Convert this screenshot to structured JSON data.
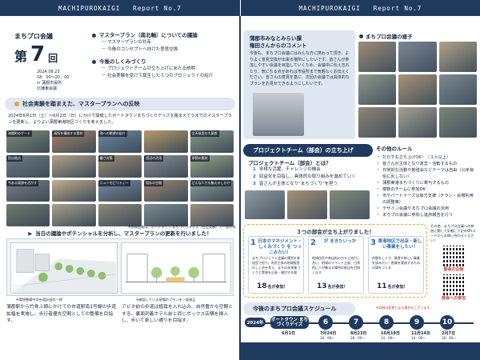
{
  "header": {
    "left": {
      "org": "MACHIPUROKAIGI",
      "issue": "Report  No.7"
    },
    "right": {
      "org": "MACHIPUROKAIGI",
      "issue": "Report  No.7"
    }
  },
  "title": {
    "name": "まちプロ会議",
    "dai": "第",
    "number": "7",
    "kai": "回",
    "date": "2024.08.23",
    "time": "18：00～20：00",
    "venue_prefix": "in",
    "venue_line1": "蒲郡市役所",
    "venue_line2": "北棟東会議"
  },
  "agenda": [
    {
      "heading": "マスタープラン（南北軸）についての議論",
      "items": [
        "マスタープランの共有",
        "今後のコンセプトへ向けた意見交換"
      ]
    },
    {
      "heading": "今後のしくみづくり",
      "items": [
        "プロジェクトチームの立ち上げにあたる説明",
        "社会実験を受けて誕生した３つのプロジェクトの紹介"
      ]
    }
  ],
  "section1": {
    "title": "社会実験を踏まえた、マスタープランへの反映",
    "intro": "2024年6月1日（土）～6月2日（日）にかけて開催したポートタウンまちづくりデイズを踏まえてラまでのマスタープランを更新し、よりよい蒲郡東港地区づくりを考えました。"
  },
  "photo_captions": [
    "海陽町のゲート",
    "高所を構成する素材",
    "海への眺望の抜け",
    "",
    "全天候型の大屋根",
    "防災拠点",
    "",
    "暑さ対策",
    "窓辺の活用",
    "季節の素材",
    "今ある資源を活かす",
    "",
    "ニューモビリティー",
    "既存の空間",
    "どんな人でも集えるしかけ",
    "",
    "",
    "",
    "",
    ""
  ],
  "notes": {
    "photos": "※画像出典は、ポートタウン まちづくりデイズ（社会実験）で一部作成",
    "drawing_left": "※環境整備中の歩道計画の一例",
    "drawing_right": "※確認している現場のプランを一部修正"
  },
  "section2_title": "当日の議論やポテンシャルを分析し、マスタープランの更新を行いました！",
  "bottom_left_text": "蒲郡駅から竹島ふ頭にかけての市道駅南1号線の歩道拡幅を実施し、歩行者優先空間としての整備を目指す。",
  "bottom_right_text": "アピタ前の歩道は植栽を入れ込み、自然豊かな空間とする。裏面到着ホテル前と同じボックス店舗を挿入し、歩いて楽しい通りを目指す。",
  "comment": {
    "title1": "蒲郡市みなとみらい課",
    "title2": "権田さんからのコメント",
    "body": "今後も、まちプロ会議にはみんな方に携わって頂き、よりよく意見交換が出来る場所にしたいです。皆さんが参加しやすい会議を目指していくため、会議中に伝え忘れたり、気になる点があれば市役所まで気軽なくお伝えください。皆さんの意見を基に、次回の会議では具体的なプランをお見せできるようにしたいです。"
  },
  "scene_label": "まちプロ会議の様子",
  "project": {
    "header": "プロジェクトチーム（部会）の立ち上げ",
    "question": "プロジェクトチーム（部会）とは？",
    "items": [
      "多様な活躍、チャレンジの機会",
      "収益化を目指し、具体的な取り組みを進めていく",
      "皆さんが主体となり\"まちづくり\"を担う"
    ]
  },
  "rules": {
    "heading": "その他のルール",
    "items": [
      "だれでも立ち上げOK！（３人以上）",
      "皆さんが主体となり運営・活動するもの",
      "日常的な活動や勉強会などテーマは自由（公序良俗に反しない）",
      "蒲郡東港まちづくりに寄与するもの",
      "複数のチームに参加OK",
      "市やパートナーズは後方支援（チラシ・会場利用の調整等）",
      "デザイン会議やまちプロ会議の活用",
      "まちプロ会議に参加し進捗報告を行う"
    ]
  },
  "groups": {
    "heading": "３つの部会が立ち上がりました！",
    "cards": [
      {
        "n": "1",
        "title": "日本のマネジメント・しくみづくり を つっこみたい！",
        "desc": "まちプロジェクト会議の運営を参加型で担う。市民主体の地域経営のしくみを考え、まちの未来像づくりと実装を企画・検討する場",
        "count": "18",
        "unit": "名が参加！"
      },
      {
        "n": "2",
        "title": "が まきたいっか",
        "desc": "地域住民や商店街の方々と協力し合い、地域のイベント企画、日常的に人が集まる場所の創出を目指します",
        "count": "13",
        "unit": "名が参加！"
      },
      {
        "n": "3",
        "title": "東港地区で出店・新しい事業をしたい！",
        "desc": "仲間をしくり、飲食や新しい事業を試みたい・創業を実践するための場をつくる",
        "count": "11",
        "unit": "名が参加！"
      }
    ]
  },
  "qr": {
    "text": "その他、まちプロ会議への参加に関して気軽に下記のQRコードからお問い合わせください！",
    "label1": "部会の企画",
    "label2": "部会への参加"
  },
  "schedule": {
    "heading": "今後のまちプロ会議スケジュール",
    "note": "※詳細は変更となる場合がございます。",
    "year": "2024年",
    "event": "ポートタウン まちづくりデイズ",
    "event_date": "6月1日",
    "nodes": [
      {
        "n": "6",
        "date": "7月24日",
        "time": "18：00～"
      },
      {
        "n": "7",
        "date": "8月23日",
        "time": "18：00～"
      },
      {
        "n": "8",
        "date": "10月19日",
        "time": "14：00～"
      },
      {
        "n": "9",
        "date": "12月14日",
        "time": "14：00～"
      },
      {
        "n": "10",
        "date": "2月7日",
        "time": "18：00～"
      }
    ]
  }
}
